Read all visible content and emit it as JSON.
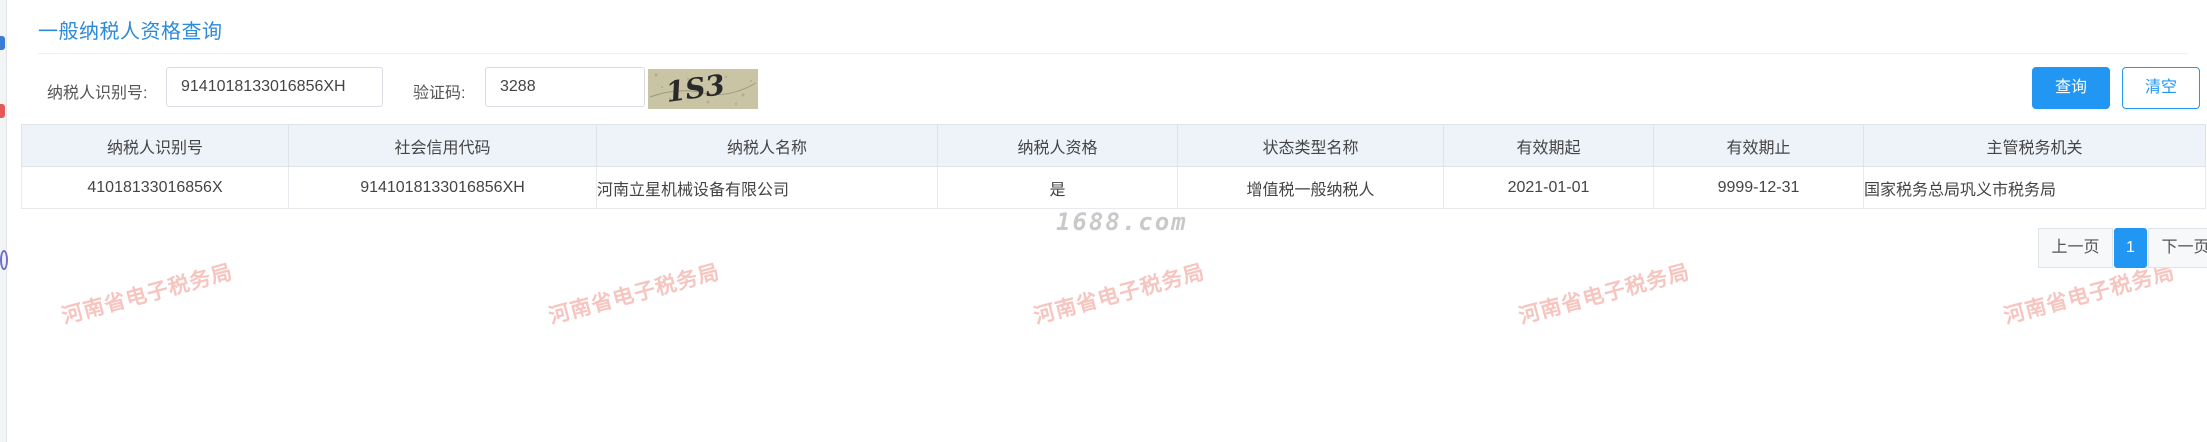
{
  "page": {
    "title": "一般纳税人资格查询"
  },
  "form": {
    "taxpayer_id_label": "纳税人识别号:",
    "taxpayer_id_value": "9141018133016856XH",
    "captcha_label": "验证码:",
    "captcha_value": "3288",
    "captcha_image_text": "1S3"
  },
  "buttons": {
    "query": "查询",
    "clear": "清空"
  },
  "table": {
    "headers": [
      "纳税人识别号",
      "社会信用代码",
      "纳税人名称",
      "纳税人资格",
      "状态类型名称",
      "有效期起",
      "有效期止",
      "主管税务机关"
    ],
    "rows": [
      [
        "41018133016856X",
        "9141018133016856XH",
        "河南立星机械设备有限公司",
        "是",
        "增值税一般纳税人",
        "2021-01-01",
        "9999-12-31",
        "国家税务总局巩义市税务局"
      ]
    ]
  },
  "pagination": {
    "prev": "上一页",
    "current": "1",
    "next": "下一页"
  },
  "watermarks": {
    "site": "1688.com",
    "bureau": "河南省电子税务局"
  },
  "colors": {
    "accent": "#2196f3",
    "title": "#2b8ad9",
    "header_bg": "#eef3fa",
    "watermark": "#f0968c"
  }
}
